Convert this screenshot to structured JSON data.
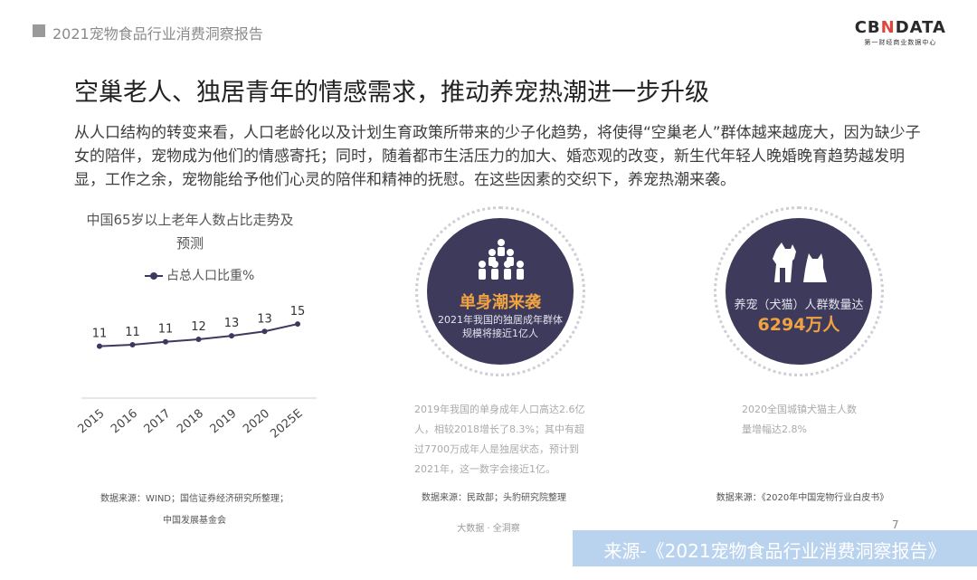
{
  "header": {
    "report_title": "2021宠物食品行业消费洞察报告",
    "logo_main_left": "CB",
    "logo_main_accent": "N",
    "logo_main_right": "DATA",
    "logo_sub": "第一财经商业数据中心"
  },
  "headline": "空巢老人、独居青年的情感需求，推动养宠热潮进一步升级",
  "body_text": "从人口结构的转变来看，人口老龄化以及计划生育政策所带来的少子化趋势，将使得“空巢老人”群体越来越庞大，因为缺少子女的陪伴，宠物成为他们的情感寄托；同时，随着都市生活压力的加大、婚恋观的改变，新生代年轻人晚婚晚育趋势越发明显，工作之余，宠物能给予他们心灵的陪伴和精神的抚慰。在这些因素的交织下，养宠热潮来袭。",
  "chart_data": {
    "type": "line",
    "title": "中国65岁以上老年人数占比走势及预测",
    "categories": [
      "2015",
      "2016",
      "2017",
      "2018",
      "2019",
      "2020",
      "2025E"
    ],
    "series": [
      {
        "name": "占总人口比重%",
        "values": [
          10.5,
          10.8,
          11.4,
          11.9,
          12.6,
          13.5,
          15.0
        ],
        "labels": [
          "11",
          "11",
          "11",
          "12",
          "13",
          "13",
          "15"
        ]
      }
    ],
    "ylim": [
      0,
      20
    ],
    "color": "#3b3a5e",
    "source_line1": "数据来源：WIND；国信证券经济研究所整理；",
    "source_line2": "中国发展基金会"
  },
  "circle1": {
    "icon": "group-of-people-icon",
    "title": "单身潮来袭",
    "desc_line1": "2021年我国的独居成年群体",
    "desc_line2": "规模将接近1亿人",
    "note_lines": [
      "2019年我国的单身成年人口高达2.6亿",
      "人，相较2018增长了8.3%；其中有超",
      "过7700万成年人是独居状态，预计到",
      "2021年，这一数字会接近1亿。"
    ],
    "source": "数据来源：民政部；头豹研究院整理"
  },
  "circle2": {
    "icon": "dog-and-cat-icon",
    "label": "养宠（犬猫）人群数量达",
    "value": "6294万人",
    "note_lines": [
      "2020全国城镇犬猫主人数",
      "量增幅达2.8%"
    ],
    "source": "数据来源：《2020年中国宠物行业白皮书》"
  },
  "footer": {
    "brand": "大数据 · 全洞察",
    "page_number": "7",
    "banner": "来源-《2021宠物食品行业消费洞察报告》"
  },
  "colors": {
    "disc": "#3d3a5c",
    "accent": "#f0a340",
    "banner": "#b9d3ef"
  }
}
